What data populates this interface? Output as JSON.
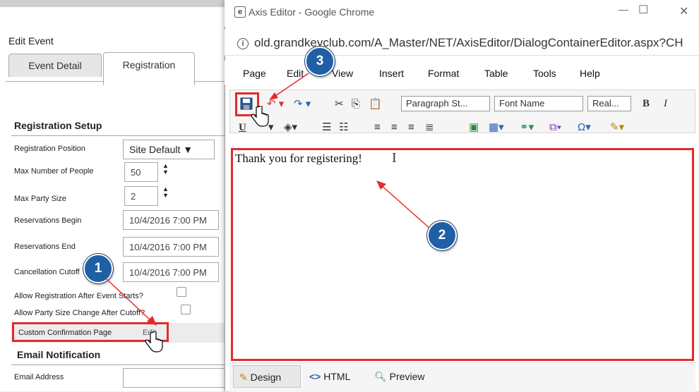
{
  "left_panel": {
    "title": "Edit Event",
    "tabs": [
      "Event Detail",
      "Registration"
    ],
    "registration_setup": {
      "heading": "Registration Setup",
      "fields": [
        {
          "label": "Registration Position",
          "value": "Site Default ▼"
        },
        {
          "label": "Max Number of People",
          "value": "50"
        },
        {
          "label": "Max Party Size",
          "value": "2"
        },
        {
          "label": "Reservations Begin",
          "value": "10/4/2016 7:00 PM"
        },
        {
          "label": "Reservations End",
          "value": "10/4/2016 7:00 PM"
        },
        {
          "label": "Cancellation Cutoff",
          "value": "10/4/2016 7:00 PM"
        }
      ],
      "allow_after_start": "Allow Registration After Event Starts?",
      "allow_party_change": "Allow Party Size Change After Cutoff?",
      "custom_confirmation": "Custom Confirmation Page",
      "edit_link": "Edit"
    },
    "email_notification": {
      "heading": "Email Notification",
      "email_label": "Email Address",
      "email_value": ""
    }
  },
  "chrome_window": {
    "title": "Axis Editor - Google Chrome",
    "url": "old.grandkeyclub.com/A_Master/NET/AxisEditor/DialogContainerEditor.aspx?CH",
    "controls": {
      "minimize": "—",
      "maximize": "☐",
      "close": "✕"
    }
  },
  "editor": {
    "menu": [
      "Page",
      "Edit",
      "View",
      "Insert",
      "Format",
      "Table",
      "Tools",
      "Help"
    ],
    "toolbar": {
      "paragraph_style": "Paragraph St...",
      "font_name": "Font Name",
      "font_size": "Real...",
      "bold": "B",
      "italic": "I"
    },
    "content": "Thank you for registering!",
    "bottom_tabs": [
      "Design",
      "HTML",
      "Preview"
    ]
  },
  "annotations": {
    "badge_1": "1",
    "badge_2": "2",
    "badge_3": "3",
    "highlight_color": "#e32a2a",
    "badge_color": "#1f5fa6"
  }
}
